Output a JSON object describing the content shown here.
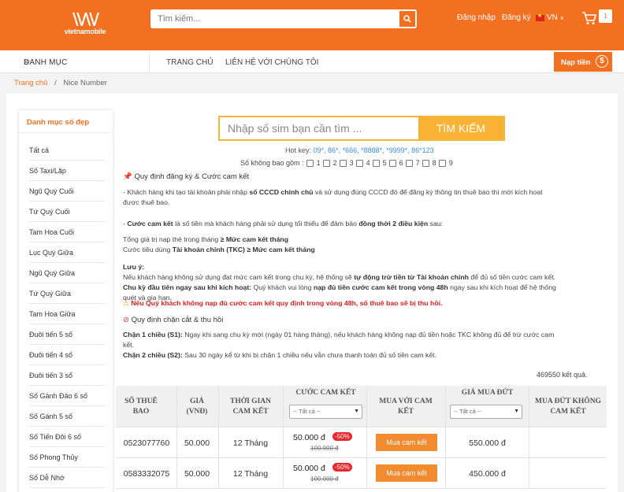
{
  "header": {
    "brand": "vietnamobile",
    "search_placeholder": "Tìm kiếm...",
    "login": "Đăng nhập",
    "register": "Đăng ký",
    "lang": "VN",
    "cart_count": "1"
  },
  "nav": {
    "category": "DANH MỤC",
    "home": "TRANG CHỦ",
    "contact": "LIÊN HỆ VỚI CHÚNG TÔI",
    "topup": "Nạp tiền",
    "topup_symbol": "$"
  },
  "breadcrumb": {
    "home": "Trang chủ",
    "sep": "/",
    "current": "Nice Number"
  },
  "sidebar": {
    "title": "Danh mục số đẹp",
    "items": [
      "Tất cả",
      "Số Taxi/Lặp",
      "Ngũ Quý Cuối",
      "Tứ Quý Cuối",
      "Tam Hoa Cuối",
      "Lục Quý Giữa",
      "Ngũ Quý Giữa",
      "Tứ Quý Giữa",
      "Tam Hoa Giữa",
      "Đuôi tiến 5 số",
      "Đuôi tiến 4 số",
      "Đuôi tiến 3 số",
      "Số Gánh Đảo 6 số",
      "Số Gánh 5 số",
      "Số Tiến Đôi 6 số",
      "Số Phong Thủy",
      "Số Dễ Nhớ"
    ]
  },
  "search": {
    "placeholder": "Nhập số sim bạn cần tìm ...",
    "button": "TÌM KIẾM"
  },
  "hotkey": {
    "label": "Hot key:",
    "keys": "09*, 86*, *666, *8888*, *9999*, 86*123"
  },
  "exclude": {
    "label": "Số không bao gồm :",
    "digits": [
      "1",
      "2",
      "3",
      "4",
      "5",
      "6",
      "7",
      "8",
      "9"
    ]
  },
  "rules": {
    "reg_title": "Quy định đăng ký & Cước cam kết",
    "p1a": "- Khách hàng khi tạo tài khoản phải nhập ",
    "p1b": "số CCCD chính chủ",
    "p1c": " và sử dụng đúng CCCD đó để đăng ký thông tin thuê bao thì mới kích hoạt",
    "p1d": "được thuê bao.",
    "p2a": "- ",
    "p2b": "Cước cam kết",
    "p2c": " là số tiền mà khách hàng phải sử dụng tối thiểu để đảm bảo ",
    "p2d": "đồng thời 2 điều kiện",
    "p2e": " sau:",
    "c1a": "Tổng giá trị nạp thẻ trong tháng ",
    "c1b": "≥ Mức cam kết tháng",
    "c2a": "Cước tiêu dùng ",
    "c2b": "Tài khoản chính (TKC) ≥ Mức cam kết tháng",
    "note_title": "Lưu ý:",
    "n1a": "Nếu khách hàng không sử dụng đạt mức cam kết trong chu kỳ, hệ thống sẽ ",
    "n1b": "tự động trừ tiền từ Tài khoản chính",
    "n1c": " để đủ số tiền cước cam kết.",
    "n2a": "Chu kỳ đầu tiên ngay sau khi kích hoạt:",
    "n2b": " Quý khách vui lòng ",
    "n2c": "nạp đủ tiền cước cam kết trong vòng 48h",
    "n2d": " ngay sau khi kích hoạt để hệ thống",
    "n2e": "quét và gia hạn.",
    "warn": "Nếu Quý khách không nạp đủ cước cam kết quy định trong vòng 48h, số thuê bao sẽ bị thu hồi.",
    "cut_title": "Quy định chặn cắt & thu hồi",
    "s1a": "Chặn 1 chiều (S1):",
    "s1b": " Ngay khi sang chu kỳ mới (ngày 01 hàng tháng), nếu khách hàng không nạp đủ tiền hoặc TKC không đủ để trừ cước cam",
    "s1c": "kết.",
    "s2a": "Chặn 2 chiều (S2):",
    "s2b": " Sau 30 ngày kể từ khi bị chặn 1 chiều nếu vẫn chưa thanh toán đủ số tiền cam kết."
  },
  "results": "469550 kết quả.",
  "table": {
    "headers": {
      "number_1": "SỐ THUÊ",
      "number_2": "BAO",
      "price_1": "GIÁ",
      "price_2": "(VNĐ)",
      "period_1": "THỜI GIAN",
      "period_2": "CAM KẾT",
      "commit": "CƯỚC CAM KẾT",
      "buy_1": "MUA VỚI CAM",
      "buy_2": "KẾT",
      "outright": "GIÁ MUA ĐỨT",
      "nocommit_1": "MUA ĐỨT KHÔNG",
      "nocommit_2": "CAM KẾT"
    },
    "filter_all": "-- Tất cả --",
    "buy_label": "Mua cam kết",
    "rows": [
      {
        "number": "0523077760",
        "price": "50.000",
        "period": "12 Tháng",
        "commit_new": "50.000 đ",
        "discount": "-50%",
        "commit_old": "100.000 đ",
        "outright": "550.000 đ"
      },
      {
        "number": "0583332075",
        "price": "50.000",
        "period": "12 Tháng",
        "commit_new": "50.000 đ",
        "discount": "-50%",
        "commit_old": "100.000 đ",
        "outright": "450.000 đ"
      }
    ]
  },
  "colors": {
    "brand_orange": "#f37021",
    "search_yellow": "#f9b233",
    "link_blue": "#3c8dde",
    "discount_red": "#e8262b"
  }
}
